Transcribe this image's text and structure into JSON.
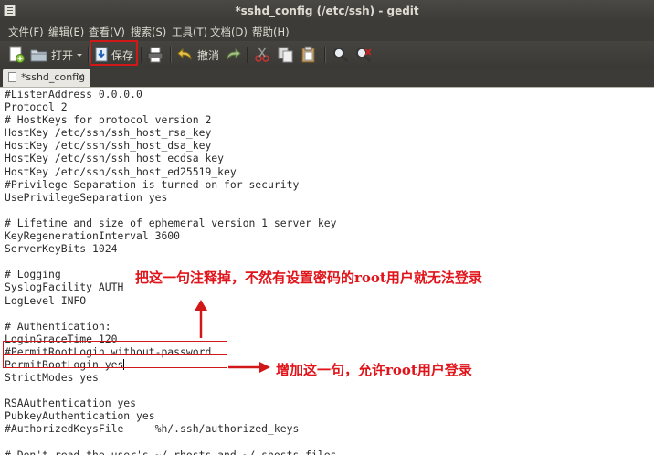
{
  "window": {
    "title": "*sshd_config (/etc/ssh) - gedit"
  },
  "menu": [
    "文件(F)",
    "编辑(E)",
    "查看(V)",
    "搜索(S)",
    "工具(T)",
    "文档(D)",
    "帮助(H)"
  ],
  "toolbar": {
    "open_label": "打开",
    "save_label": "保存",
    "undo_label": "撤消"
  },
  "tab": {
    "label": "*sshd_config",
    "close": "×"
  },
  "editor": {
    "lines": [
      "#ListenAddress 0.0.0.0",
      "Protocol 2",
      "# HostKeys for protocol version 2",
      "HostKey /etc/ssh/ssh_host_rsa_key",
      "HostKey /etc/ssh/ssh_host_dsa_key",
      "HostKey /etc/ssh/ssh_host_ecdsa_key",
      "HostKey /etc/ssh/ssh_host_ed25519_key",
      "#Privilege Separation is turned on for security",
      "UsePrivilegeSeparation yes",
      "",
      "# Lifetime and size of ephemeral version 1 server key",
      "KeyRegenerationInterval 3600",
      "ServerKeyBits 1024",
      "",
      "# Logging",
      "SyslogFacility AUTH",
      "LogLevel INFO",
      "",
      "# Authentication:",
      "LoginGraceTime 120",
      "#PermitRootLogin without-password",
      "PermitRootLogin yes",
      "StrictModes yes",
      "",
      "RSAAuthentication yes",
      "PubkeyAuthentication yes",
      "#AuthorizedKeysFile     %h/.ssh/authorized_keys",
      "",
      "# Don't read the user's ~/.rhosts and ~/.shosts files"
    ]
  },
  "annotations": {
    "comment_note": "把这一句注释掉，不然有设置密码的root用户就无法登录",
    "add_note": "增加这一句，允许root用户登录"
  },
  "colors": {
    "annotation": "#e0141a",
    "titlebar": "#3c3b37"
  }
}
